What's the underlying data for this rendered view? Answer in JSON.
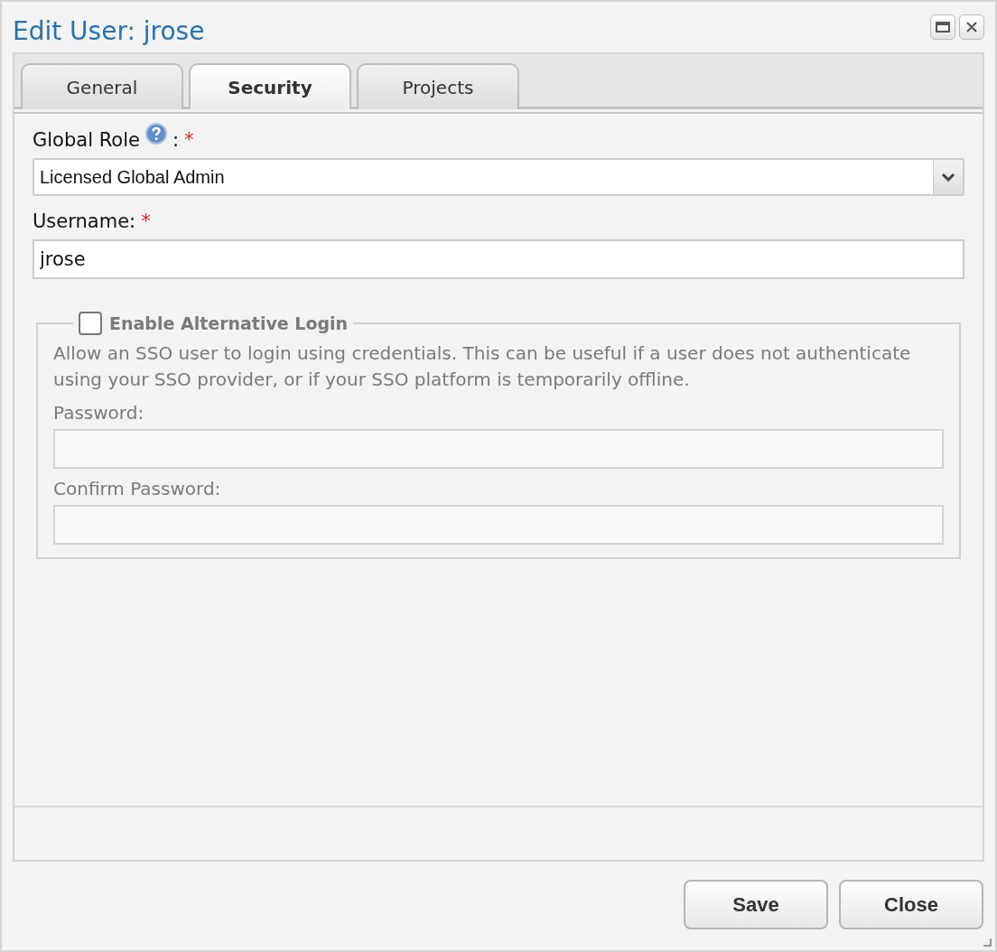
{
  "window": {
    "title": "Edit User: jrose"
  },
  "tabs": [
    {
      "label": "General",
      "selected": false
    },
    {
      "label": "Security",
      "selected": true
    },
    {
      "label": "Projects",
      "selected": false
    }
  ],
  "global_role": {
    "label": "Global Role",
    "colon": ":",
    "required_mark": "*",
    "value": "Licensed Global Admin"
  },
  "username": {
    "label": "Username:",
    "required_mark": "*",
    "value": "jrose"
  },
  "alternative_login": {
    "label": "Enable Alternative Login",
    "checked": false,
    "description": "Allow an SSO user to login using credentials. This can be useful if a user does not authenticate using your SSO provider, or if your SSO platform is temporarily offline.",
    "fields": [
      {
        "label": "Password:"
      },
      {
        "label": "Confirm Password:"
      }
    ]
  },
  "buttons": [
    {
      "label": "Save"
    },
    {
      "label": "Close"
    }
  ]
}
